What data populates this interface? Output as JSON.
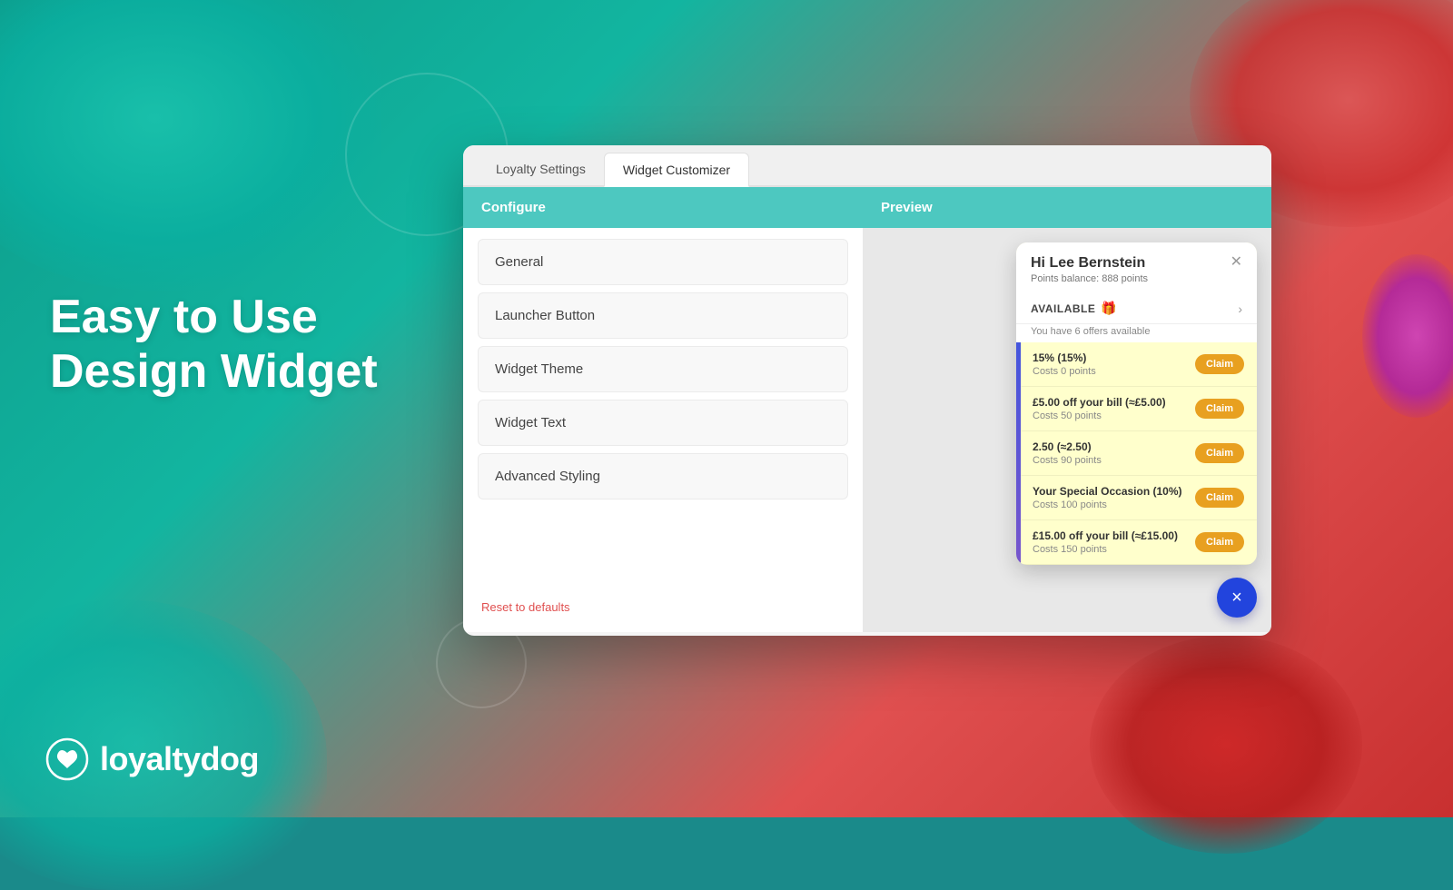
{
  "background": {
    "colors": {
      "teal": "#0aafa0",
      "red": "#cc3030",
      "purple": "#aa22aa"
    }
  },
  "heading": {
    "line1": "Easy to Use",
    "line2": "Design Widget"
  },
  "logo": {
    "text": "loyaltydog"
  },
  "modal": {
    "tabs": [
      {
        "label": "Loyalty Settings",
        "active": false
      },
      {
        "label": "Widget Customizer",
        "active": true
      }
    ],
    "configure": {
      "header": "Configure",
      "items": [
        {
          "label": "General"
        },
        {
          "label": "Launcher Button"
        },
        {
          "label": "Widget Theme"
        },
        {
          "label": "Widget Text"
        },
        {
          "label": "Advanced Styling"
        }
      ],
      "reset_label": "Reset to defaults"
    },
    "preview": {
      "header": "Preview"
    }
  },
  "widget": {
    "greeting": "Hi Lee Bernstein",
    "points_label": "Points balance: 888 points",
    "available_label": "AVAILABLE",
    "available_sub": "You have 6 offers available",
    "offers": [
      {
        "title": "15% (15%)",
        "cost": "Costs 0 points",
        "btn": "Claim"
      },
      {
        "title": "£5.00 off your bill (≈£5.00)",
        "cost": "Costs 50 points",
        "btn": "Claim"
      },
      {
        "title": "2.50 (≈2.50)",
        "cost": "Costs 90 points",
        "btn": "Claim"
      },
      {
        "title": "Your Special Occasion (10%)",
        "cost": "Costs 100 points",
        "btn": "Claim"
      },
      {
        "title": "£15.00 off your bill (≈£15.00)",
        "cost": "Costs 150 points",
        "btn": "Claim"
      }
    ],
    "close_fab": "×"
  }
}
